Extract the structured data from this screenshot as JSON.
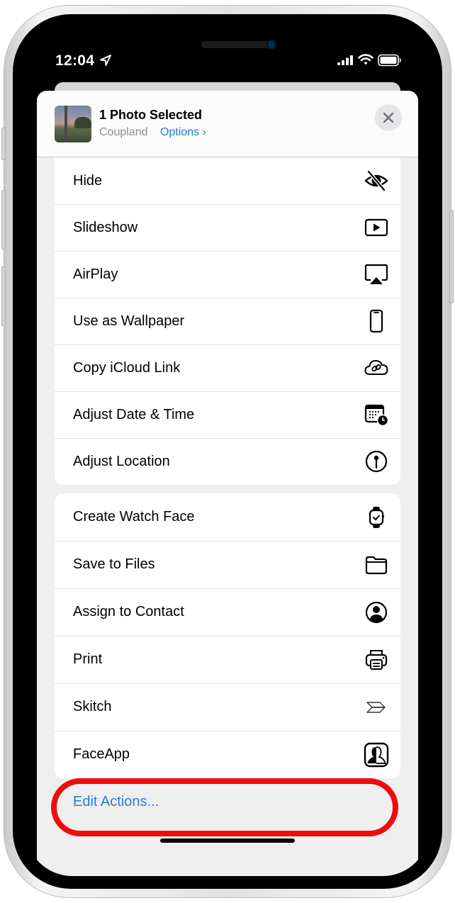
{
  "status_bar": {
    "time": "12:04",
    "icons": [
      "location-arrow-icon",
      "cellular-signal-icon",
      "wifi-icon",
      "battery-icon"
    ]
  },
  "share_sheet": {
    "title": "1 Photo Selected",
    "subtitle": "Coupland",
    "options_label": "Options ›",
    "close_icon": "close-icon"
  },
  "groups": [
    {
      "items": [
        {
          "label": "Hide",
          "icon": "eye-slash-icon"
        },
        {
          "label": "Slideshow",
          "icon": "play-rectangle-icon"
        },
        {
          "label": "AirPlay",
          "icon": "airplay-icon"
        },
        {
          "label": "Use as Wallpaper",
          "icon": "iphone-icon"
        },
        {
          "label": "Copy iCloud Link",
          "icon": "cloud-link-icon"
        },
        {
          "label": "Adjust Date & Time",
          "icon": "calendar-clock-icon"
        },
        {
          "label": "Adjust Location",
          "icon": "map-pin-circle-icon"
        }
      ]
    },
    {
      "items": [
        {
          "label": "Create Watch Face",
          "icon": "apple-watch-icon"
        },
        {
          "label": "Save to Files",
          "icon": "folder-icon"
        },
        {
          "label": "Assign to Contact",
          "icon": "person-circle-icon"
        },
        {
          "label": "Print",
          "icon": "printer-icon"
        },
        {
          "label": "Skitch",
          "icon": "skitch-arrow-icon"
        },
        {
          "label": "FaceApp",
          "icon": "faceapp-icon"
        }
      ]
    }
  ],
  "edit_actions_label": "Edit Actions...",
  "colors": {
    "link_blue": "#2a7ad5",
    "highlight_red": "#ee0d0d",
    "sheet_background": "#efeff0"
  }
}
